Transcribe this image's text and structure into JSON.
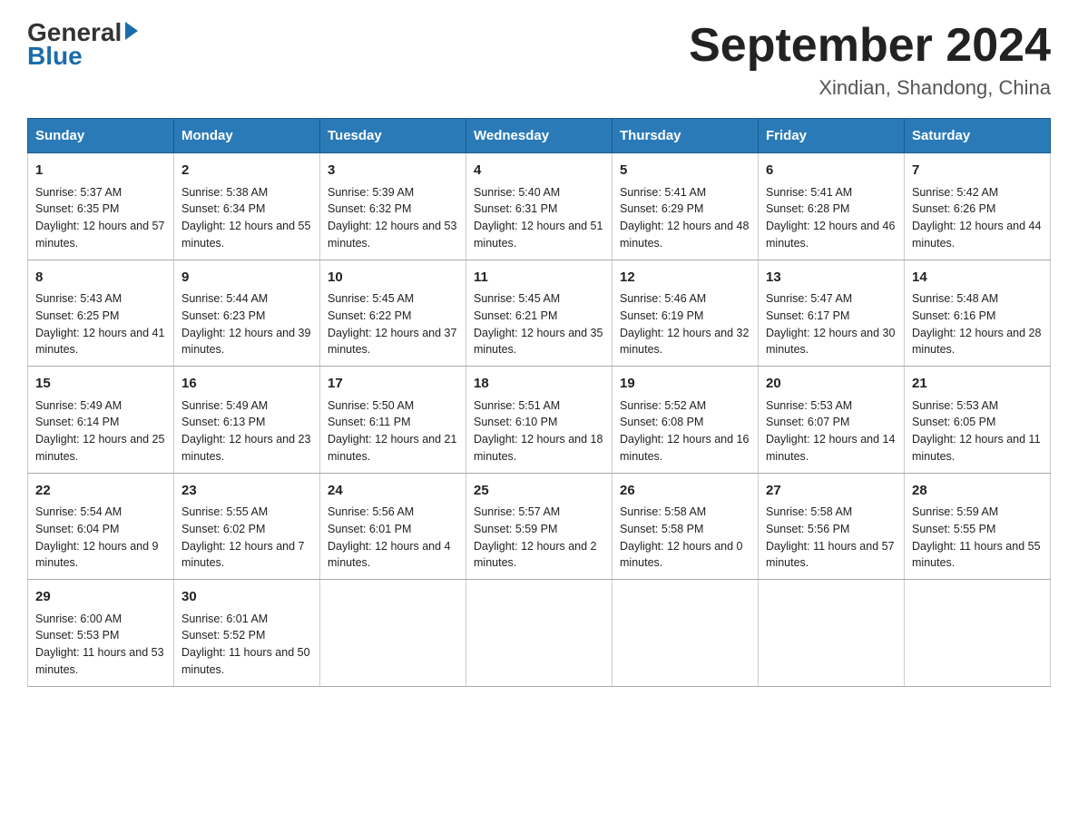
{
  "logo": {
    "general": "General",
    "blue": "Blue"
  },
  "title": "September 2024",
  "location": "Xindian, Shandong, China",
  "days": [
    "Sunday",
    "Monday",
    "Tuesday",
    "Wednesday",
    "Thursday",
    "Friday",
    "Saturday"
  ],
  "weeks": [
    [
      {
        "num": "1",
        "sunrise": "5:37 AM",
        "sunset": "6:35 PM",
        "daylight": "12 hours and 57 minutes."
      },
      {
        "num": "2",
        "sunrise": "5:38 AM",
        "sunset": "6:34 PM",
        "daylight": "12 hours and 55 minutes."
      },
      {
        "num": "3",
        "sunrise": "5:39 AM",
        "sunset": "6:32 PM",
        "daylight": "12 hours and 53 minutes."
      },
      {
        "num": "4",
        "sunrise": "5:40 AM",
        "sunset": "6:31 PM",
        "daylight": "12 hours and 51 minutes."
      },
      {
        "num": "5",
        "sunrise": "5:41 AM",
        "sunset": "6:29 PM",
        "daylight": "12 hours and 48 minutes."
      },
      {
        "num": "6",
        "sunrise": "5:41 AM",
        "sunset": "6:28 PM",
        "daylight": "12 hours and 46 minutes."
      },
      {
        "num": "7",
        "sunrise": "5:42 AM",
        "sunset": "6:26 PM",
        "daylight": "12 hours and 44 minutes."
      }
    ],
    [
      {
        "num": "8",
        "sunrise": "5:43 AM",
        "sunset": "6:25 PM",
        "daylight": "12 hours and 41 minutes."
      },
      {
        "num": "9",
        "sunrise": "5:44 AM",
        "sunset": "6:23 PM",
        "daylight": "12 hours and 39 minutes."
      },
      {
        "num": "10",
        "sunrise": "5:45 AM",
        "sunset": "6:22 PM",
        "daylight": "12 hours and 37 minutes."
      },
      {
        "num": "11",
        "sunrise": "5:45 AM",
        "sunset": "6:21 PM",
        "daylight": "12 hours and 35 minutes."
      },
      {
        "num": "12",
        "sunrise": "5:46 AM",
        "sunset": "6:19 PM",
        "daylight": "12 hours and 32 minutes."
      },
      {
        "num": "13",
        "sunrise": "5:47 AM",
        "sunset": "6:17 PM",
        "daylight": "12 hours and 30 minutes."
      },
      {
        "num": "14",
        "sunrise": "5:48 AM",
        "sunset": "6:16 PM",
        "daylight": "12 hours and 28 minutes."
      }
    ],
    [
      {
        "num": "15",
        "sunrise": "5:49 AM",
        "sunset": "6:14 PM",
        "daylight": "12 hours and 25 minutes."
      },
      {
        "num": "16",
        "sunrise": "5:49 AM",
        "sunset": "6:13 PM",
        "daylight": "12 hours and 23 minutes."
      },
      {
        "num": "17",
        "sunrise": "5:50 AM",
        "sunset": "6:11 PM",
        "daylight": "12 hours and 21 minutes."
      },
      {
        "num": "18",
        "sunrise": "5:51 AM",
        "sunset": "6:10 PM",
        "daylight": "12 hours and 18 minutes."
      },
      {
        "num": "19",
        "sunrise": "5:52 AM",
        "sunset": "6:08 PM",
        "daylight": "12 hours and 16 minutes."
      },
      {
        "num": "20",
        "sunrise": "5:53 AM",
        "sunset": "6:07 PM",
        "daylight": "12 hours and 14 minutes."
      },
      {
        "num": "21",
        "sunrise": "5:53 AM",
        "sunset": "6:05 PM",
        "daylight": "12 hours and 11 minutes."
      }
    ],
    [
      {
        "num": "22",
        "sunrise": "5:54 AM",
        "sunset": "6:04 PM",
        "daylight": "12 hours and 9 minutes."
      },
      {
        "num": "23",
        "sunrise": "5:55 AM",
        "sunset": "6:02 PM",
        "daylight": "12 hours and 7 minutes."
      },
      {
        "num": "24",
        "sunrise": "5:56 AM",
        "sunset": "6:01 PM",
        "daylight": "12 hours and 4 minutes."
      },
      {
        "num": "25",
        "sunrise": "5:57 AM",
        "sunset": "5:59 PM",
        "daylight": "12 hours and 2 minutes."
      },
      {
        "num": "26",
        "sunrise": "5:58 AM",
        "sunset": "5:58 PM",
        "daylight": "12 hours and 0 minutes."
      },
      {
        "num": "27",
        "sunrise": "5:58 AM",
        "sunset": "5:56 PM",
        "daylight": "11 hours and 57 minutes."
      },
      {
        "num": "28",
        "sunrise": "5:59 AM",
        "sunset": "5:55 PM",
        "daylight": "11 hours and 55 minutes."
      }
    ],
    [
      {
        "num": "29",
        "sunrise": "6:00 AM",
        "sunset": "5:53 PM",
        "daylight": "11 hours and 53 minutes."
      },
      {
        "num": "30",
        "sunrise": "6:01 AM",
        "sunset": "5:52 PM",
        "daylight": "11 hours and 50 minutes."
      },
      null,
      null,
      null,
      null,
      null
    ]
  ],
  "labels": {
    "sunrise": "Sunrise: ",
    "sunset": "Sunset: ",
    "daylight": "Daylight: "
  }
}
